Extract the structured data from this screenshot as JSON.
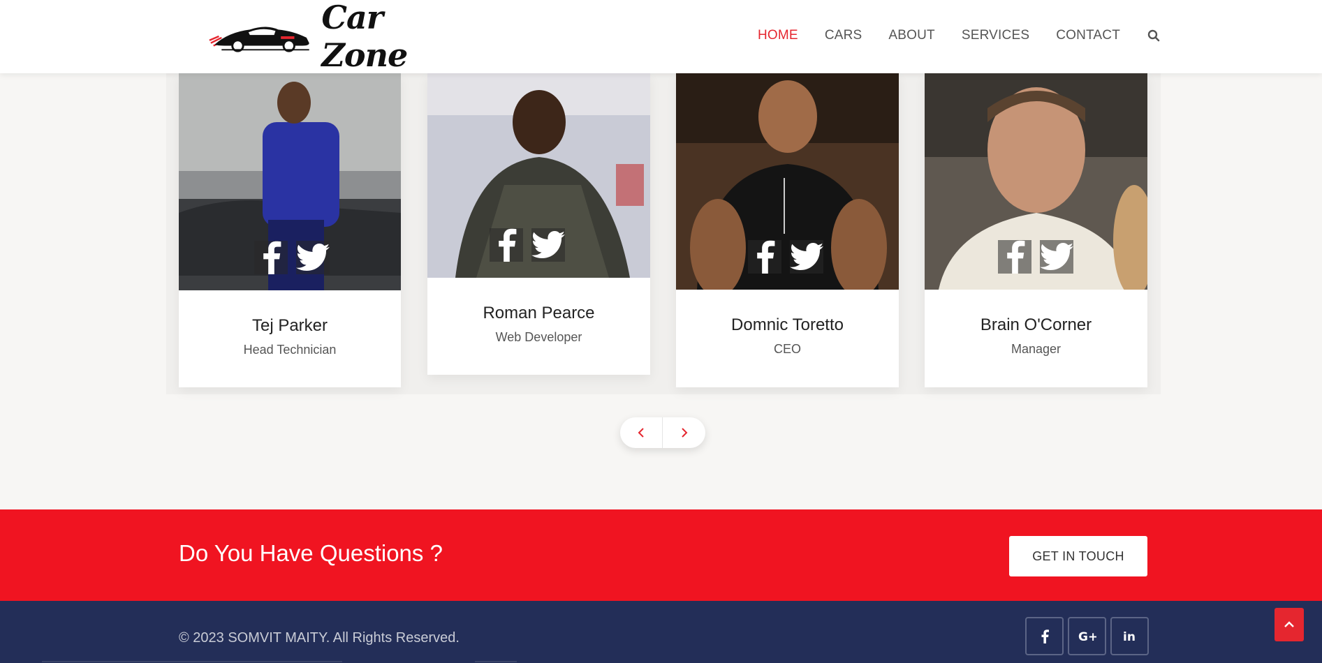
{
  "header": {
    "logo_text": "Car Zone",
    "nav": [
      "HOME",
      "CARS",
      "ABOUT",
      "SERVICES",
      "CONTACT"
    ],
    "active_nav": "HOME"
  },
  "team": [
    {
      "name": "Tej Parker",
      "role": "Head Technician"
    },
    {
      "name": "Roman Pearce",
      "role": "Web Developer"
    },
    {
      "name": "Domnic Toretto",
      "role": "CEO"
    },
    {
      "name": "Brain O'Corner",
      "role": "Manager"
    }
  ],
  "cta": {
    "title": "Do You Have Questions ?",
    "button": "GET IN TOUCH"
  },
  "footer": {
    "copyright": "© 2023 SOMVIT MAITY. All Rights Reserved."
  },
  "colors": {
    "accent": "#e5262f",
    "cta_bg": "#f01421",
    "footer_bg": "#232e58"
  },
  "icons": {
    "search": "search-icon",
    "facebook": "facebook-icon",
    "twitter": "twitter-icon",
    "google_plus": "google-plus-icon",
    "linkedin": "linkedin-icon",
    "prev": "chevron-left-icon",
    "next": "chevron-right-icon",
    "to_top": "chevron-up-icon"
  }
}
